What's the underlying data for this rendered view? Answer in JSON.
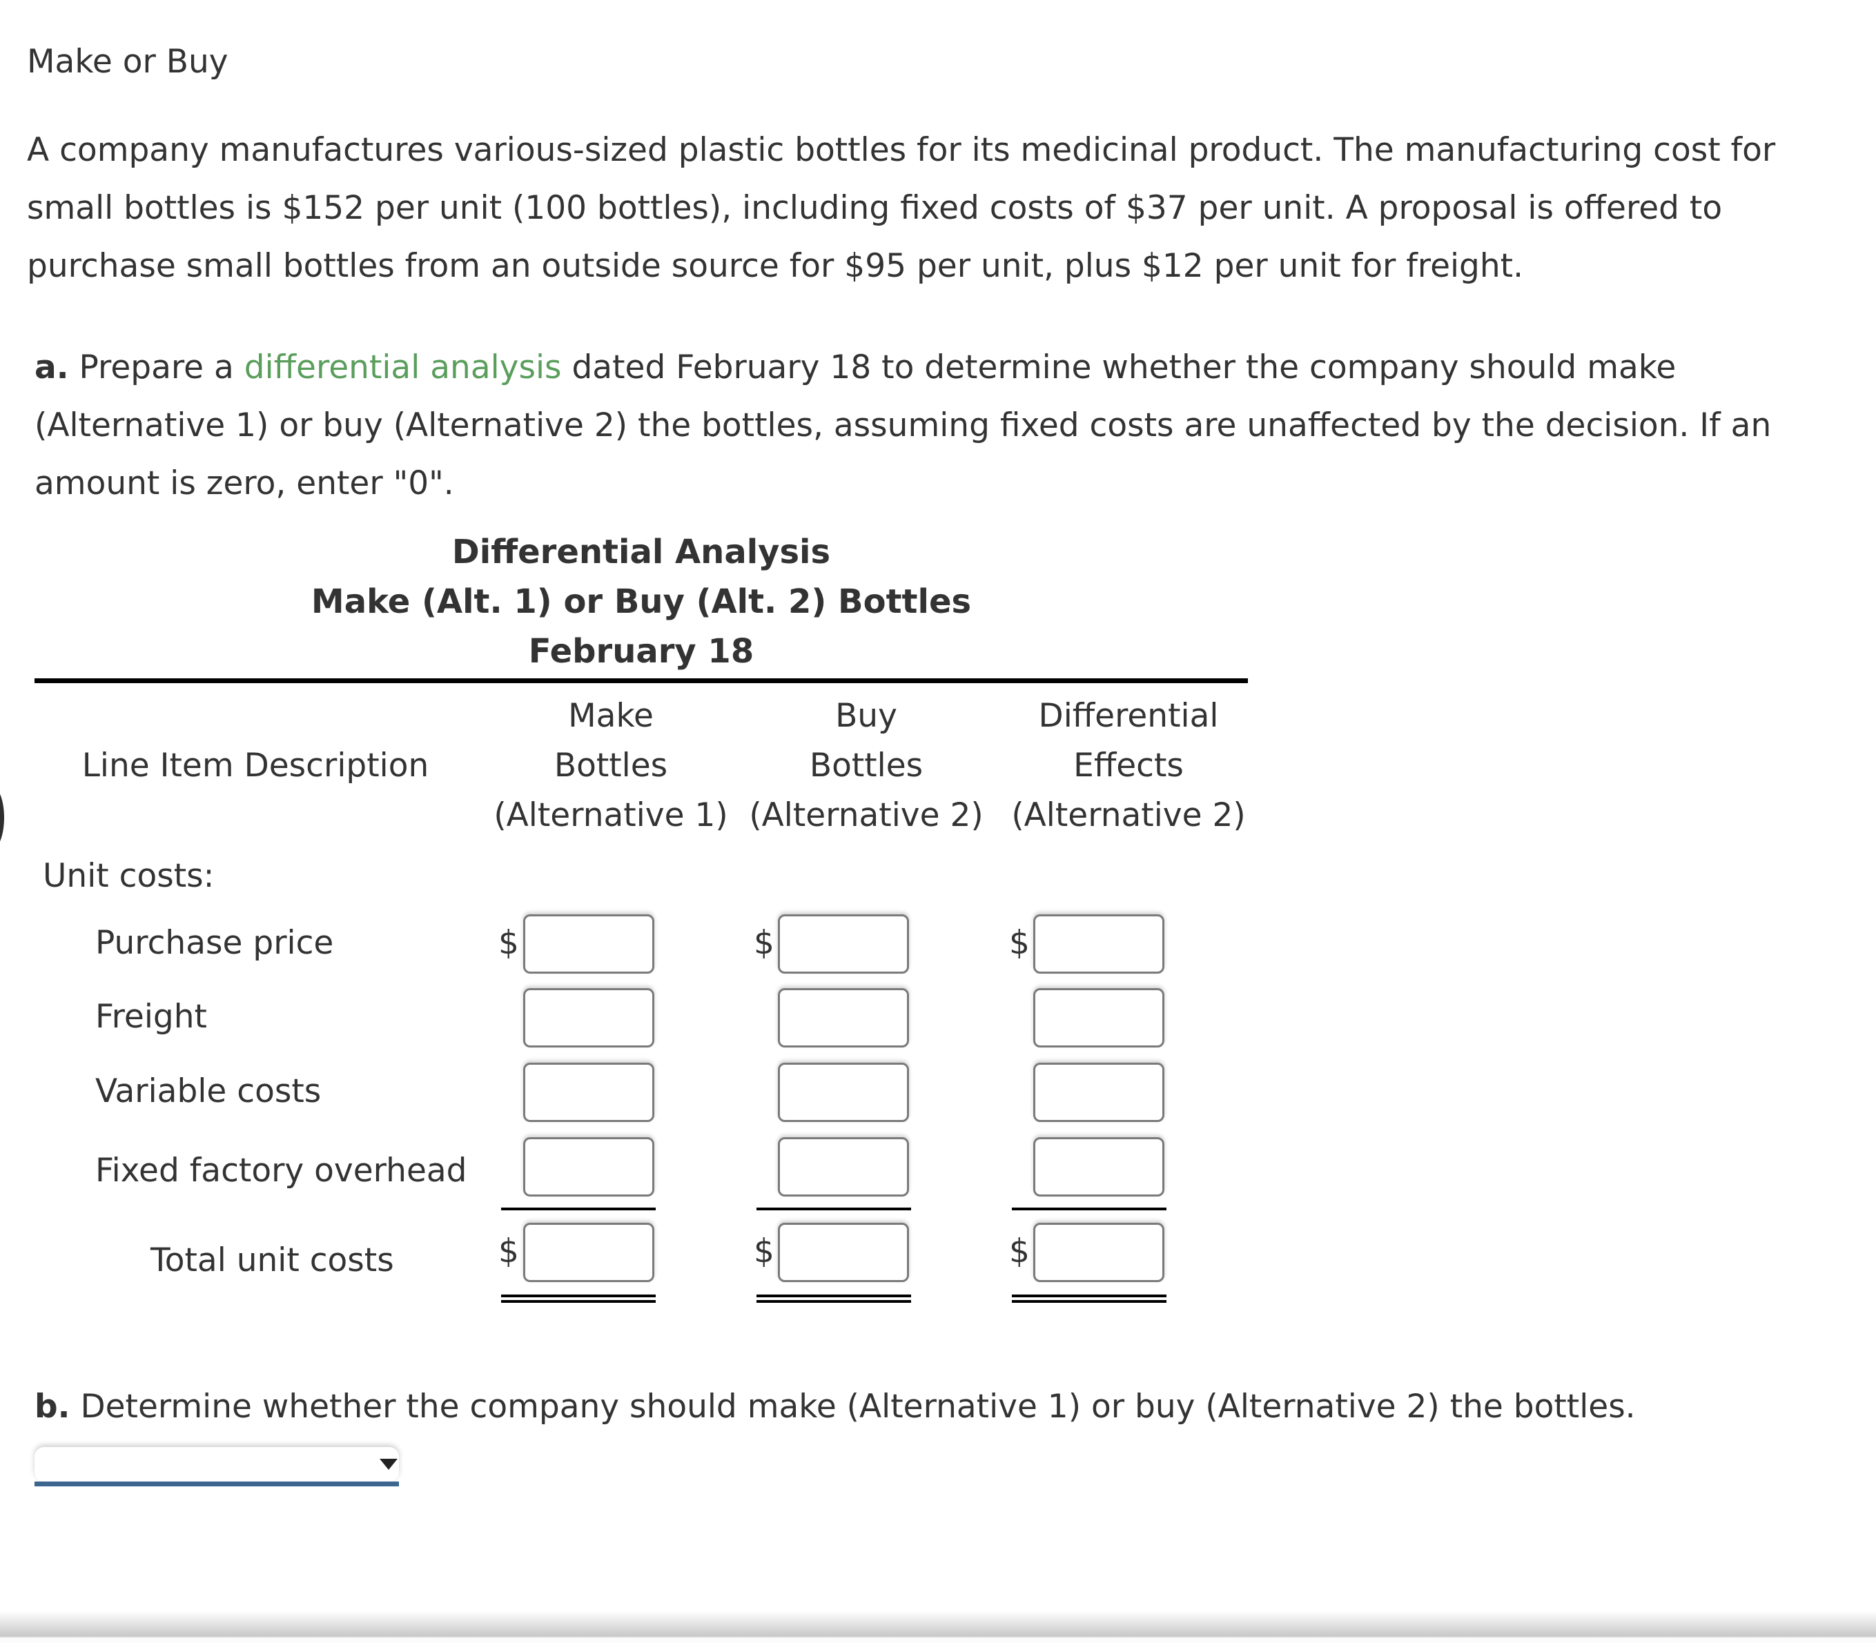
{
  "section_title": "Make or Buy",
  "problem_text": "A company manufactures various-sized plastic bottles for its medicinal product. The manufacturing cost for small bottles is $152 per unit (100 bottles), including fixed costs of $37 per unit. A proposal is offered to purchase small bottles from an outside source for $95 per unit, plus $12 per unit for freight.",
  "part_a": {
    "label": "a.",
    "text_before": " Prepare a ",
    "link_text": "differential analysis",
    "text_after": " dated February 18 to determine whether the company should make (Alternative 1) or buy (Alternative 2) the bottles, assuming fixed costs are unaffected by the decision. If an amount is zero, enter \"0\".",
    "link_color": "#5a9e5c"
  },
  "statement": {
    "title_lines": [
      "Differential Analysis",
      "Make (Alt. 1) or Buy (Alt. 2) Bottles",
      "February 18"
    ],
    "columns": {
      "description": "Line Item Description",
      "make": [
        "Make",
        "Bottles",
        "(Alternative 1)"
      ],
      "buy": [
        "Buy",
        "Bottles",
        "(Alternative 2)"
      ],
      "differential": [
        "Differential",
        "Effects",
        "(Alternative 2)"
      ]
    },
    "section_label": "Unit costs:",
    "currency_symbol": "$",
    "rows": [
      {
        "label": "Purchase price",
        "make": "",
        "buy": "",
        "differential": ""
      },
      {
        "label": "Freight",
        "make": "",
        "buy": "",
        "differential": ""
      },
      {
        "label": "Variable costs",
        "make": "",
        "buy": "",
        "differential": ""
      },
      {
        "label": "Fixed factory overhead",
        "make": "",
        "buy": "",
        "differential": ""
      }
    ],
    "total_row": {
      "label": "Total unit costs",
      "make": "",
      "buy": "",
      "differential": ""
    }
  },
  "part_b": {
    "label": "b.",
    "text": " Determine whether the company should make (Alternative 1) or buy (Alternative 2) the bottles.",
    "select_value": "",
    "select_accent_color": "#3c6590"
  }
}
